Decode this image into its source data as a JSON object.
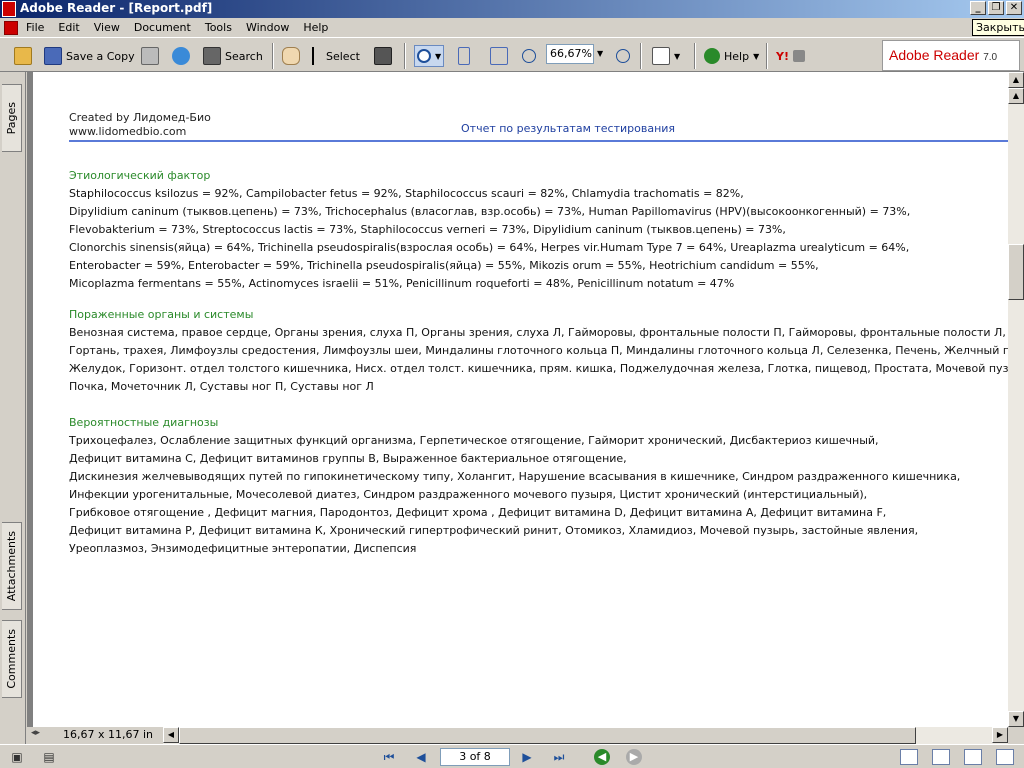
{
  "window": {
    "title": "Adobe Reader - [Report.pdf]",
    "minimize": "_",
    "restore": "❐",
    "close": "✕",
    "tooltip": "Закрыть"
  },
  "menu": [
    "File",
    "Edit",
    "View",
    "Document",
    "Tools",
    "Window",
    "Help"
  ],
  "toolbar": {
    "save_copy": "Save a Copy",
    "search": "Search",
    "select": "Select",
    "zoom": "66,67%",
    "help": "Help",
    "yahoo": "Y!"
  },
  "brand": {
    "name": "Adobe Reader",
    "version": "7.0"
  },
  "nav_tabs": [
    "Pages",
    "Attachments",
    "Comments"
  ],
  "document": {
    "created_by": "Created by Лидомед-Био",
    "website": "www.lidomedbio.com",
    "report_title": "Отчет по результатам тестирования",
    "sections": [
      {
        "title": "Этиологический фактор",
        "lines": [
          "Staphilococcus  ksilozus = 92%, Campilobacter fetus = 92%, Staphilococcus scauri = 82%, Chlamydia trachomatis = 82%,",
          "Dipylidium caninum (тыквов.цепень) = 73%, Trichocephalus (власоглав, взр.особь) = 73%, Human Papillomavirus (HPV)(высокоонкогенный) = 73%,",
          "Flevobakterium = 73%, Streptococcus lactis = 73%, Staphilococcus verneri = 73%, Dipylidium caninum (тыквов.цепень) = 73%,",
          "Clonorchis sinensis(яйца) = 64%, Trichinella pseudospiralis(взрослая особь) = 64%, Herpes vir.Humam Type 7 = 64%, Ureaplazma urealyticum = 64%,",
          "Enterobacter = 59%, Enterobacter = 59%, Trichinella pseudospiralis(яйца) = 55%, Mikozis orum = 55%, Heotrichium candidum = 55%,",
          "Micoplazma fermentans = 55%, Actinomyces israelii = 51%, Penicillinum roqueforti = 48%, Penicillinum notatum = 47%"
        ]
      },
      {
        "title": "Пораженные органы и системы",
        "lines": [
          "Венозная система, правое сердце, Органы зрения, слуха П, Органы зрения, слуха Л, Гайморовы, фронтальные полости П, Гайморовы, фронтальные полости Л,",
          "Гортань, трахея, Лимфоузлы средостения, Лимфоузлы шеи, Миндалины глоточного кольца П, Миндалины глоточного кольца Л, Селезенка, Печень, Желчный пузырь,",
          "Желудок, Горизонт. отдел толстого кишечника, Нисх. отдел толст. кишечника, прям. кишка, Поджелудочная железа, Глотка, пищевод, Простата, Мочевой пузырь,",
          "Почка, Мочеточник Л, Суставы ног П, Суставы ног Л"
        ]
      },
      {
        "title": "Вероятностные диагнозы",
        "lines": [
          "Трихоцефалез, Ослабление защитных функций организма, Герпетическое отягощение, Гайморит хронический, Дисбактериоз кишечный,",
          "Дефицит витамина С, Дефицит витаминов группы В, Выраженное бактериальное отягощение,",
          "Дискинезия желчевыводящих путей по гипокинетическому типу, Холангит, Нарушение всасывания в кишечнике, Синдром раздраженного кишечника,",
          "Инфекции урогенитальные, Мочесолевой диатез, Синдром раздраженного мочевого пузыря, Цистит хронический (интерстициальный),",
          "Грибковое отягощение , Дефицит магния, Пародонтоз, Дефицит хрома , Дефицит витамина D, Дефицит витамина А, Дефицит витамина F,",
          "Дефицит витамина Р, Дефицит витамина К, Хронический гипертрофический ринит, Отомикоз, Хламидиоз, Мочевой пузырь, застойные явления,",
          "Уреоплазмоз, Энзимодефицитные энтеропатии, Диспепсия"
        ]
      }
    ]
  },
  "status": {
    "page_size": "16,67 x 11,67 in",
    "page_indicator": "3 of 8"
  }
}
